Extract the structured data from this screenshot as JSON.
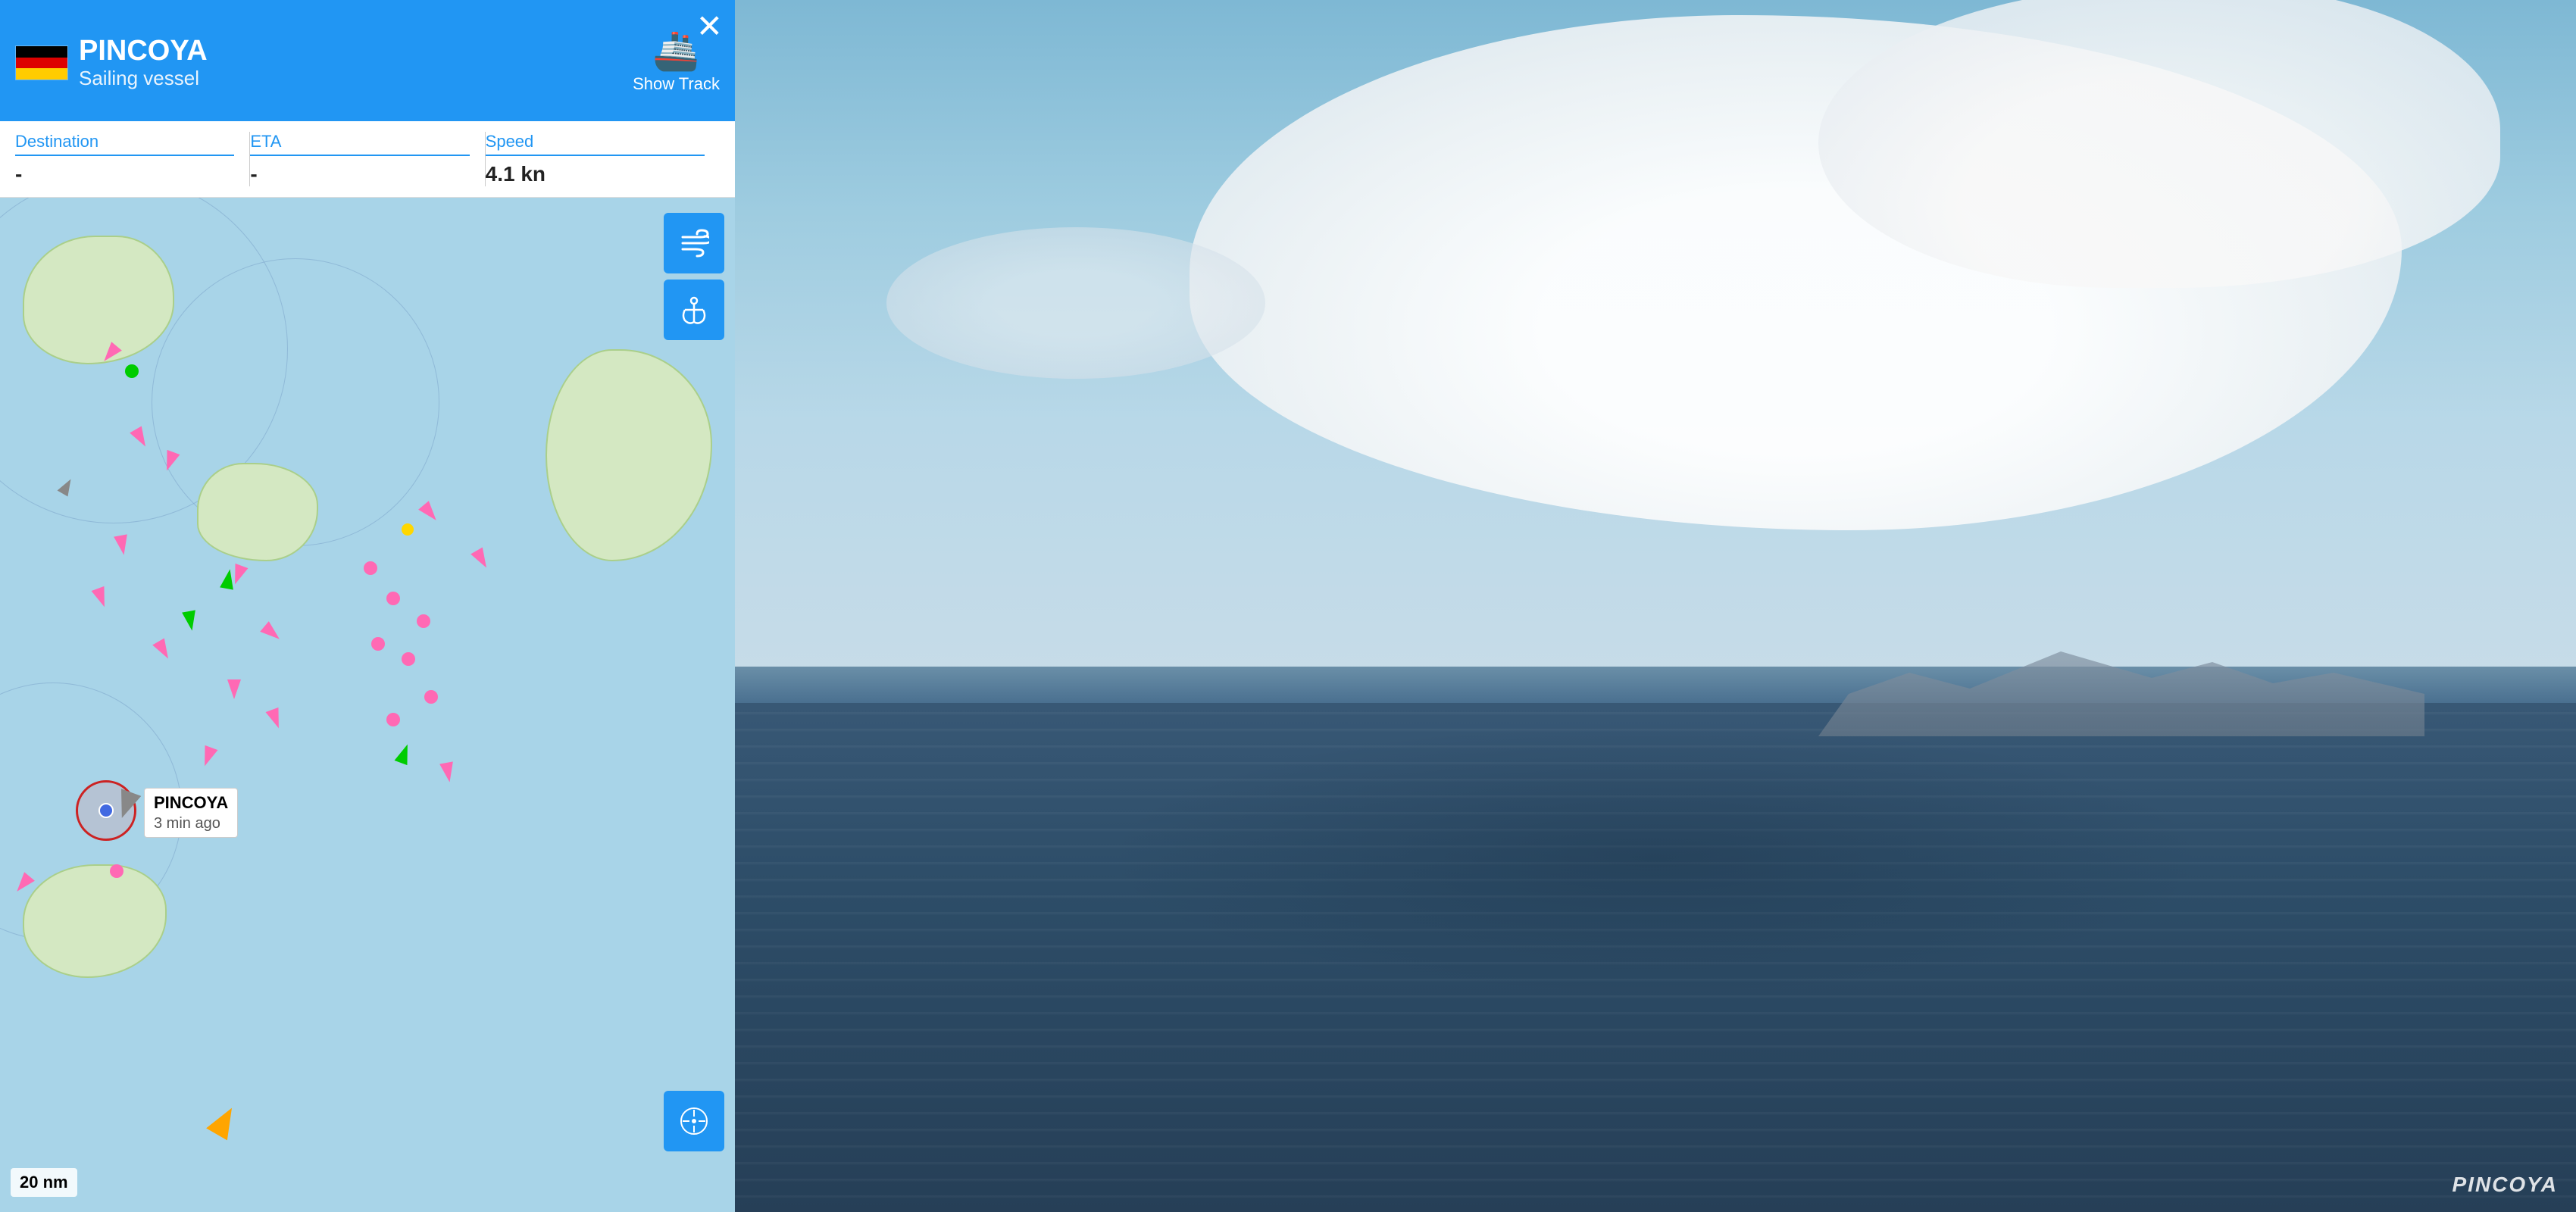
{
  "header": {
    "vessel_name": "PINCOYA",
    "vessel_type": "Sailing vessel",
    "show_track_label": "Show Track",
    "close_label": "✕"
  },
  "info_bar": {
    "destination_label": "Destination",
    "destination_value": "-",
    "eta_label": "ETA",
    "eta_value": "-",
    "speed_label": "Speed",
    "speed_value": "4.1 kn"
  },
  "map": {
    "scale_label": "20 nm"
  },
  "pincoya_popup": {
    "name": "PINCOYA",
    "last_seen": "3 min ago"
  },
  "photo": {
    "watermark": "PINCOYA"
  }
}
